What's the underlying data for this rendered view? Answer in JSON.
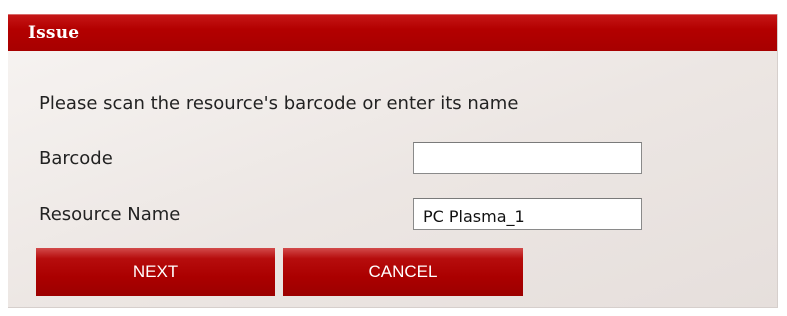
{
  "dialog": {
    "title": "Issue",
    "instruction": "Please scan the resource's barcode or enter its name"
  },
  "fields": {
    "barcode": {
      "label": "Barcode",
      "value": ""
    },
    "resource_name": {
      "label": "Resource Name",
      "value": "PC Plasma_1"
    }
  },
  "buttons": {
    "next_label": "NEXT",
    "cancel_label": "CANCEL"
  },
  "colors": {
    "accent": "#b30000",
    "button": "#ab0000",
    "panel": "#ece6e3"
  }
}
